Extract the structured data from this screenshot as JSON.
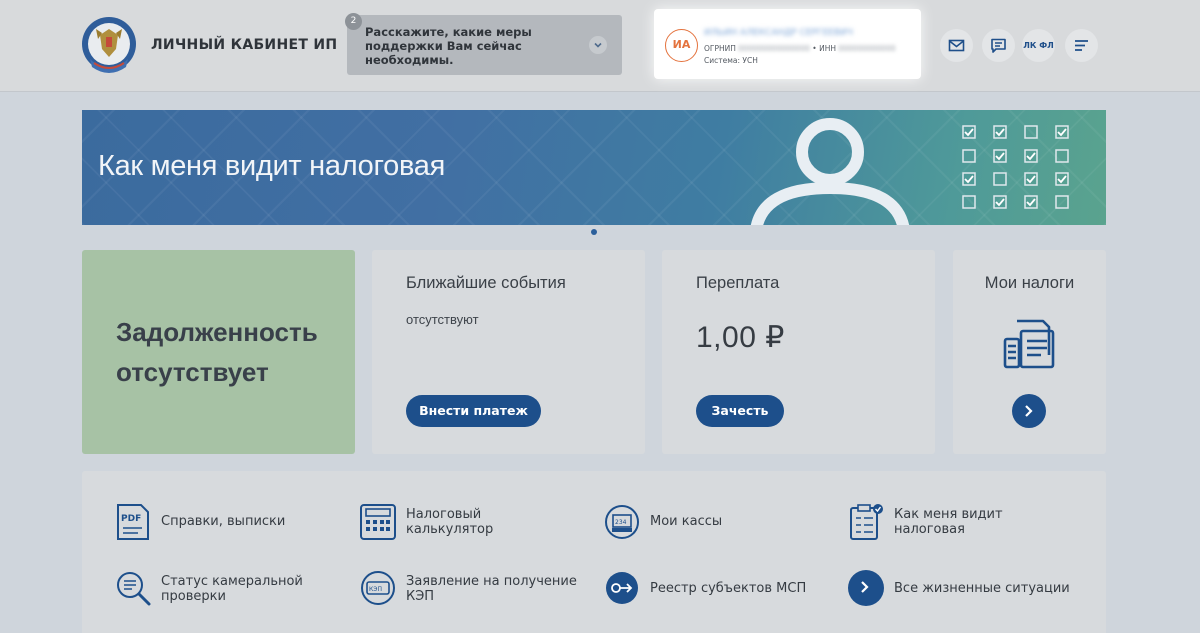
{
  "header": {
    "title": "ЛИЧНЫЙ КАБИНЕТ ИП",
    "survey": {
      "badge": "2",
      "text": "Расскажите, какие меры поддержки Вам сейчас необходимы."
    },
    "profile": {
      "initials": "ИА",
      "name_blurred": "ИЛЬИН АЛЕКСАНДР СЕРГЕЕВИЧ",
      "ogrnip_label": "ОГРНИП",
      "ogrnip_blurred": "000000000000000",
      "separator": "•",
      "inn_label": "ИНН",
      "inn_blurred": "000000000000",
      "system": "Система: УСН"
    },
    "buttons": {
      "mail_icon": "envelope-icon",
      "chat_icon": "chat-icon",
      "lk_fl": "ЛК ФЛ",
      "menu_icon": "menu-icon"
    }
  },
  "banner": {
    "title": "Как меня видит налоговая"
  },
  "cards": {
    "debt": {
      "line1": "Задолженность",
      "line2": "отсутствует"
    },
    "events": {
      "title": "Ближайшие события",
      "subtitle": "отсутствуют",
      "button": "Внести платеж"
    },
    "overpayment": {
      "title": "Переплата",
      "amount": "1,00 ₽",
      "button": "Зачесть"
    },
    "taxes": {
      "title": "Мои налоги"
    }
  },
  "services": [
    {
      "label_1": "Справки, выписки",
      "label_2": "",
      "icon": "pdf-document-icon"
    },
    {
      "label_1": "Налоговый",
      "label_2": "калькулятор",
      "icon": "calculator-icon"
    },
    {
      "label_1": "Мои кассы",
      "label_2": "",
      "icon": "cash-register-icon"
    },
    {
      "label_1": "Как меня видит",
      "label_2": "налоговая",
      "icon": "checklist-icon"
    },
    {
      "label_1": "Статус камеральной",
      "label_2": "проверки",
      "icon": "document-search-icon"
    },
    {
      "label_1": "Заявление на получение",
      "label_2": "КЭП",
      "icon": "signature-card-icon"
    },
    {
      "label_1": "Реестр субъектов МСП",
      "label_2": "",
      "icon": "registry-arrow-icon"
    },
    {
      "label_1": "Все жизненные ситуации",
      "label_2": "",
      "icon": "chevron-right-icon"
    }
  ],
  "colors": {
    "accent": "#1d4f8b",
    "debt_card": "#a7c2a5",
    "avatar": "#e4733e",
    "background": "#cfd5dc"
  }
}
